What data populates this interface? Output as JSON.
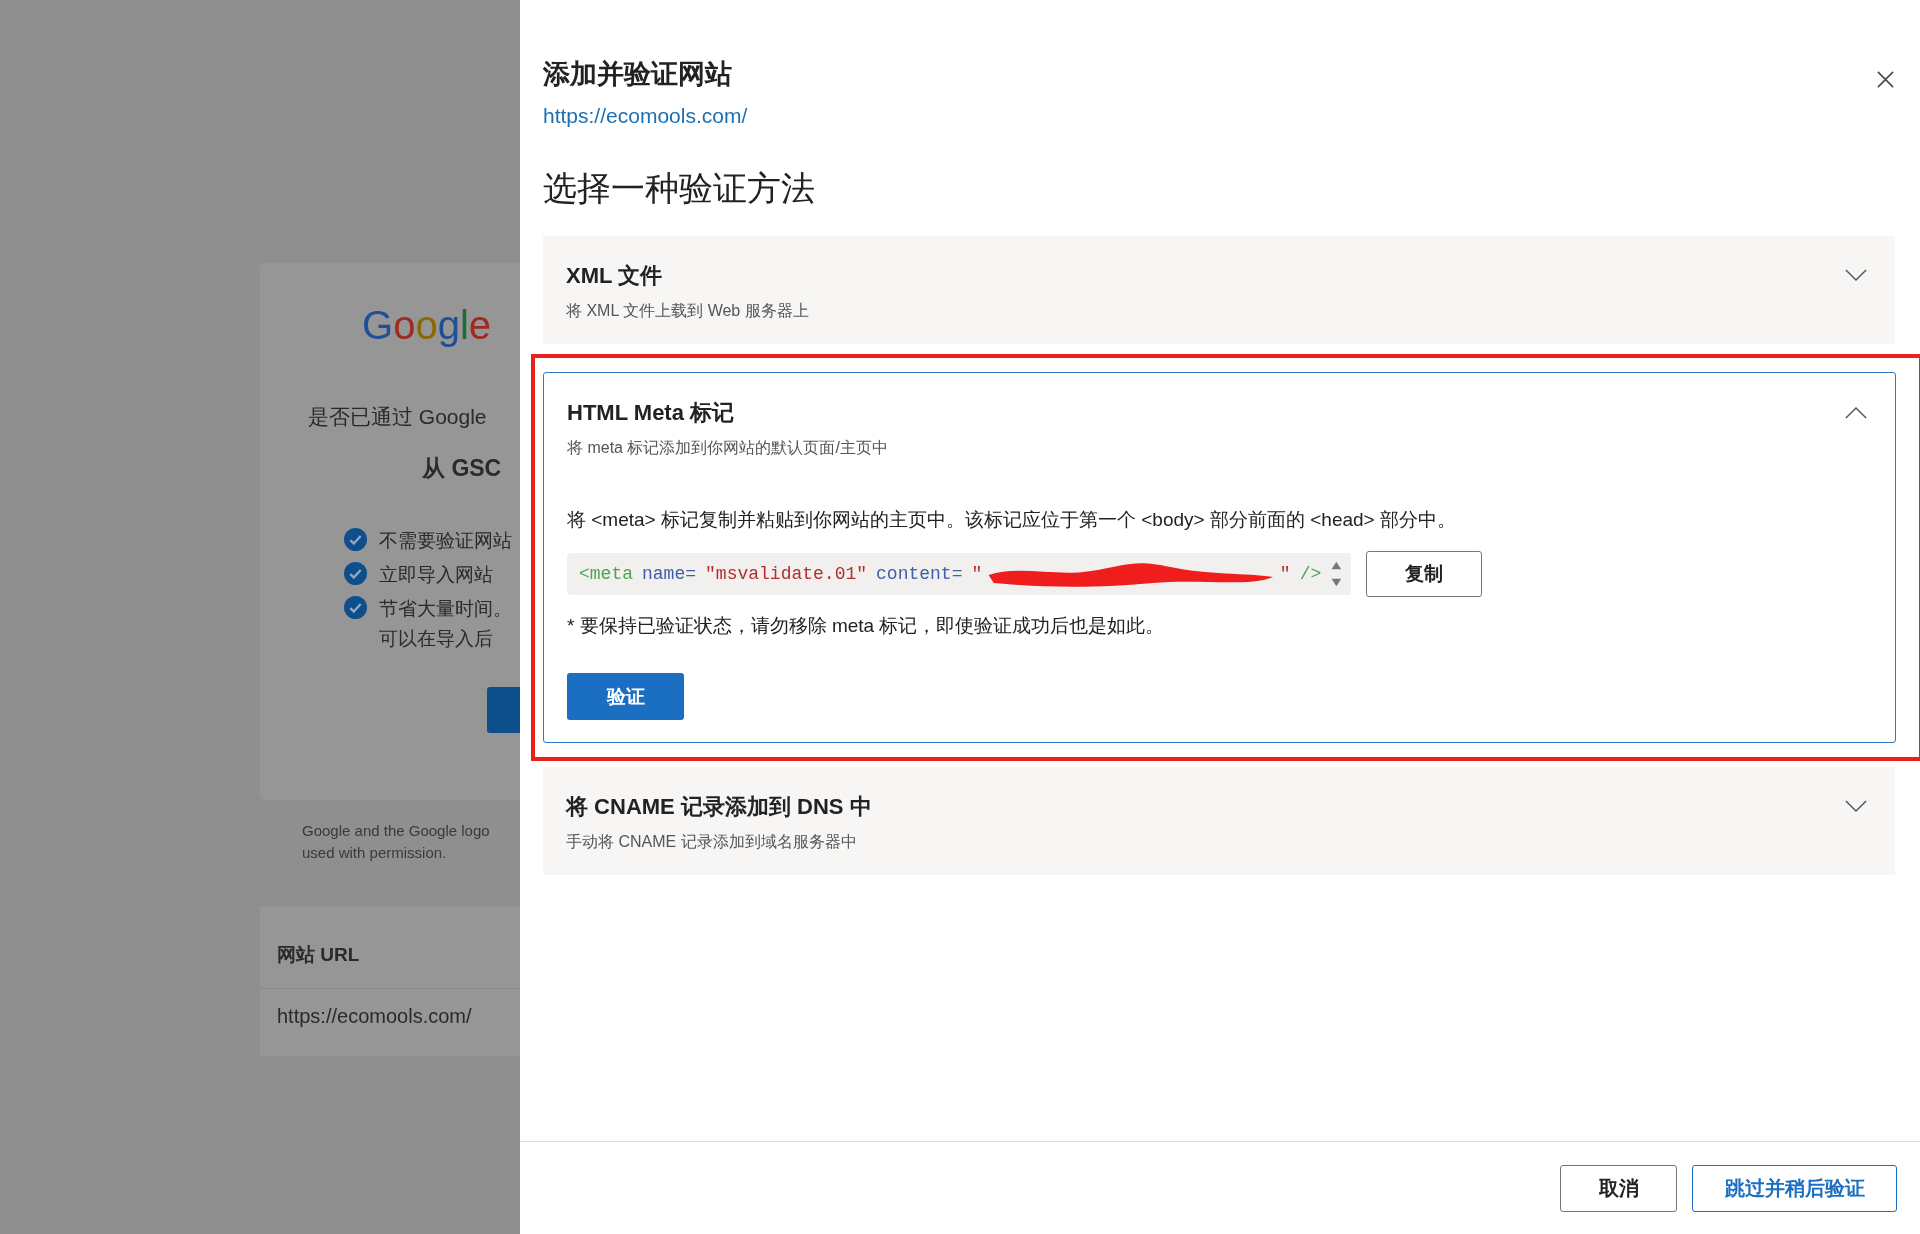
{
  "background": {
    "logo": "Google",
    "question": "是否已通过 Google",
    "subtitle": "从 GSC",
    "benefits": [
      {
        "text": "不需要验证网站"
      },
      {
        "text": "立即导入网站"
      },
      {
        "text": "节省大量时间。",
        "extra": "可以在导入后"
      }
    ],
    "legal": [
      "Google and the Google logo",
      "used with permission."
    ],
    "url_card": {
      "label": "网站 URL",
      "value": "https://ecomools.com/"
    }
  },
  "dialog": {
    "title": "添加并验证网站",
    "site": "https://ecomools.com/",
    "heading": "选择一种验证方法",
    "methods": [
      {
        "title": "XML 文件",
        "description": "将 XML 文件上载到 Web 服务器上",
        "expanded": false,
        "highlighted": false
      },
      {
        "title": "HTML Meta 标记",
        "description": "将 meta 标记添加到你网站的默认页面/主页中",
        "expanded": true,
        "highlighted": true,
        "instruction": "将 <meta> 标记复制并粘贴到你网站的主页中。该标记应位于第一个 <body> 部分前面的 <head> 部分中。",
        "code": [
          {
            "kind": "tag",
            "text": "<meta"
          },
          {
            "kind": "attr",
            "text": "name="
          },
          {
            "kind": "value",
            "text": "\"msvalidate.01\""
          },
          {
            "kind": "attr",
            "text": "content="
          },
          {
            "kind": "value",
            "text": "\""
          },
          {
            "kind": "redacted"
          },
          {
            "kind": "value",
            "text": "\""
          },
          {
            "kind": "tag",
            "text": "/>"
          }
        ],
        "copy_button": "复制",
        "note": "* 要保持已验证状态，请勿移除 meta 标记，即使验证成功后也是如此。",
        "verify_button": "验证"
      },
      {
        "title": "将 CNAME 记录添加到 DNS 中",
        "description": "手动将 CNAME 记录添加到域名服务器中",
        "expanded": false,
        "highlighted": false
      }
    ],
    "buttons": [
      {
        "label": "取消",
        "kind": "secondary"
      },
      {
        "label": "跳过并稍后验证",
        "kind": "outline"
      }
    ]
  }
}
